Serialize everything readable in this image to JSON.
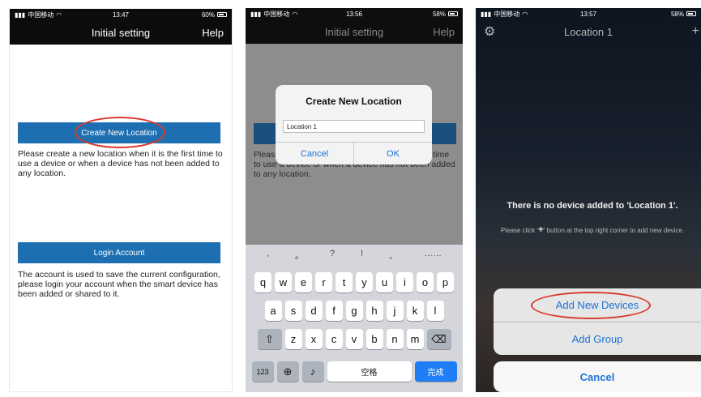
{
  "screen1": {
    "status": {
      "carrier": "中国移动",
      "time": "13:47",
      "battery": "60%"
    },
    "title": "Initial setting",
    "help": "Help",
    "create_button": "Create New Location",
    "create_desc": "Please create a new location when it is the first time to use a device or when a device has not been added to any location.",
    "login_button": "Login Account",
    "login_desc": "The account is used to save the current configuration, please login your account when the smart device has been added or shared to it."
  },
  "screen2": {
    "status": {
      "carrier": "中国移动",
      "time": "13:56",
      "battery": "58%"
    },
    "title": "Initial setting",
    "help": "Help",
    "under_text": "Please create a new location when it is the first time to use a device or when a device has not been added to any location.",
    "dialog": {
      "title": "Create New Location",
      "input_value": "Location 1",
      "cancel": "Cancel",
      "ok": "OK"
    },
    "keyboard": {
      "symbols": [
        ",",
        "。",
        "?",
        "!",
        "、",
        "……"
      ],
      "row1": [
        "q",
        "w",
        "e",
        "r",
        "t",
        "y",
        "u",
        "i",
        "o",
        "p"
      ],
      "row2": [
        "a",
        "s",
        "d",
        "f",
        "g",
        "h",
        "j",
        "k",
        "l"
      ],
      "row3": [
        "z",
        "x",
        "c",
        "v",
        "b",
        "n",
        "m"
      ],
      "num": "123",
      "space": "空格",
      "done": "完成"
    }
  },
  "screen3": {
    "status": {
      "carrier": "中国移动",
      "time": "13:57",
      "battery": "58%"
    },
    "title": "Location 1",
    "empty_title": "There is no device added to 'Location 1'.",
    "empty_hint_before": "Please click '",
    "empty_hint_after": "' button at the top right corner to add new device.",
    "add_devices": "Add New Devices",
    "add_group": "Add Group",
    "cancel": "Cancel"
  }
}
